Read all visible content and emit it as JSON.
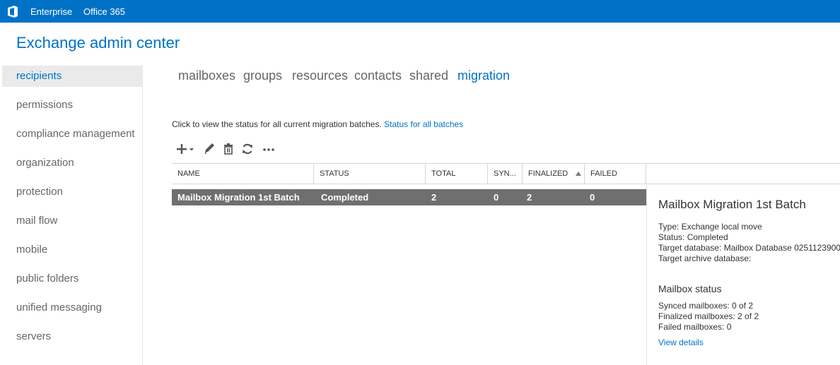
{
  "topbar": {
    "logo_icon": "office-logo-icon",
    "links": [
      "Enterprise",
      "Office 365"
    ],
    "color": "#0072c6"
  },
  "app_title": "Exchange admin center",
  "sidebar": {
    "items": [
      {
        "label": "recipients",
        "active": true
      },
      {
        "label": "permissions"
      },
      {
        "label": "compliance management"
      },
      {
        "label": "organization"
      },
      {
        "label": "protection"
      },
      {
        "label": "mail flow"
      },
      {
        "label": "mobile"
      },
      {
        "label": "public folders"
      },
      {
        "label": "unified messaging"
      },
      {
        "label": "servers"
      }
    ]
  },
  "tabs": [
    {
      "label": "mailboxes"
    },
    {
      "label": "groups"
    },
    {
      "label": "resources"
    },
    {
      "label": "contacts"
    },
    {
      "label": "shared"
    },
    {
      "label": "migration",
      "active": true
    }
  ],
  "status_text": "Click to view the status for all current migration batches.",
  "status_link": "Status for all batches",
  "toolbar": {
    "icons": [
      "add-icon",
      "edit-icon",
      "delete-icon",
      "refresh-icon",
      "more-icon"
    ]
  },
  "grid": {
    "columns": [
      "NAME",
      "STATUS",
      "TOTAL",
      "SYN...",
      "FINALIZED",
      "FAILED"
    ],
    "sorted_column": "FINALIZED",
    "rows": [
      {
        "name": "Mailbox Migration 1st Batch",
        "status": "Completed",
        "total": "2",
        "synced": "0",
        "finalized": "2",
        "failed": "0"
      }
    ]
  },
  "details": {
    "title": "Mailbox Migration 1st Batch",
    "type": "Type: Exchange local move",
    "status": "Status: Completed",
    "target_db": "Target database: Mailbox Database 0251123900",
    "target_archive": "Target archive database:",
    "mailbox_status_heading": "Mailbox status",
    "synced": "Synced mailboxes: 0 of 2",
    "finalized": "Finalized mailboxes: 2 of 2",
    "failed": "Failed mailboxes: 0",
    "view_details": "View details"
  }
}
